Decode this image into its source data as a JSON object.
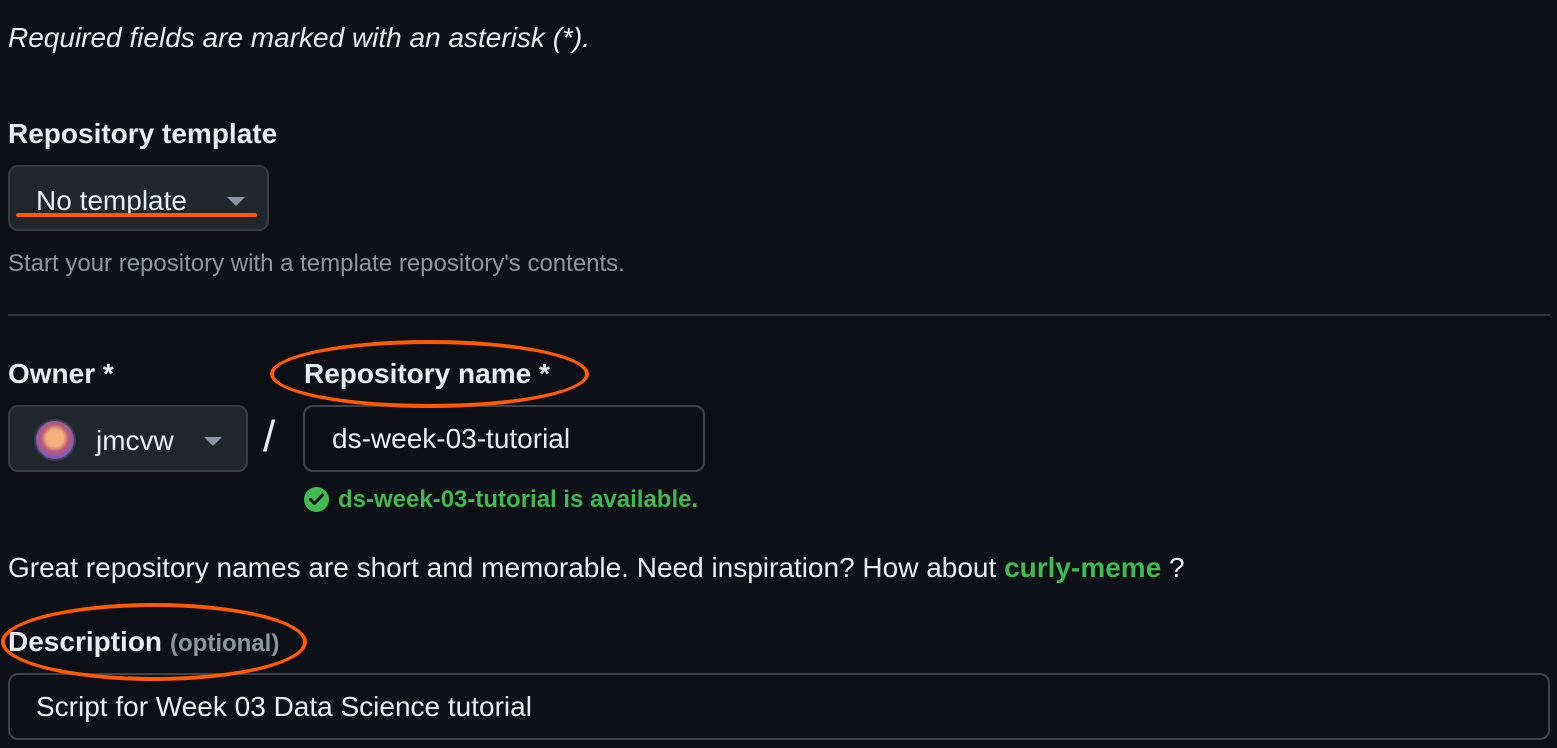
{
  "form": {
    "required_note": "Required fields are marked with an asterisk (*).",
    "template": {
      "label": "Repository template",
      "selected": "No template",
      "helper": "Start your repository with a template repository's contents."
    },
    "owner": {
      "label": "Owner *",
      "value": "jmcvw",
      "avatar_icon": "user-avatar"
    },
    "separator": "/",
    "repo_name": {
      "label": "Repository name *",
      "value": "ds-week-03-tutorial",
      "availability": "ds-week-03-tutorial is available.",
      "availability_icon": "check-circle-fill"
    },
    "suggestion": {
      "prefix": "Great repository names are short and memorable. Need inspiration? How about ",
      "name": "curly-meme",
      "suffix": " ?"
    },
    "description": {
      "label": "Description",
      "optional": "(optional)",
      "value": "Script for Week 03 Data Science tutorial"
    }
  },
  "annotations": {
    "color": "#ff5a00",
    "marks": [
      "underline-template-select",
      "circle-repository-name-label",
      "circle-description-label"
    ]
  },
  "colors": {
    "background": "#0d1117",
    "text": "#e6edf3",
    "muted": "#8d96a0",
    "success": "#3fb950",
    "button_bg": "#21262d",
    "border": "#30363d"
  }
}
